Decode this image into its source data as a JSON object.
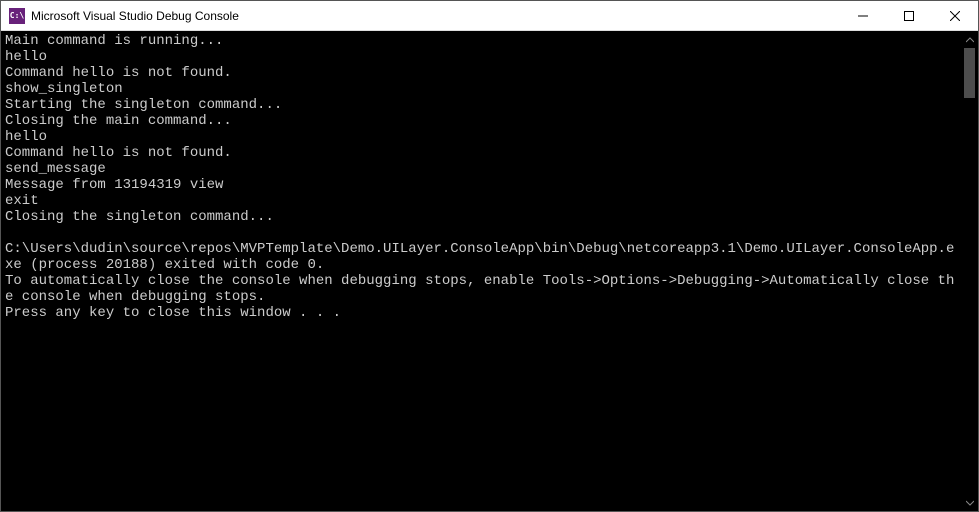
{
  "titlebar": {
    "icon_text": "C:\\",
    "title": "Microsoft Visual Studio Debug Console"
  },
  "console": {
    "lines": [
      "Main command is running...",
      "hello",
      "Command hello is not found.",
      "show_singleton",
      "Starting the singleton command...",
      "Closing the main command...",
      "hello",
      "Command hello is not found.",
      "send_message",
      "Message from 13194319 view",
      "exit",
      "Closing the singleton command...",
      "",
      "C:\\Users\\dudin\\source\\repos\\MVPTemplate\\Demo.UILayer.ConsoleApp\\bin\\Debug\\netcoreapp3.1\\Demo.UILayer.ConsoleApp.exe (process 20188) exited with code 0.",
      "To automatically close the console when debugging stops, enable Tools->Options->Debugging->Automatically close the console when debugging stops.",
      "Press any key to close this window . . ."
    ]
  }
}
